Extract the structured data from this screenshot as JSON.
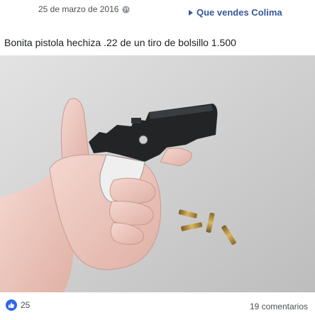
{
  "post": {
    "date": "25 de marzo de 2016",
    "privacy_icon": "globe-icon",
    "group_name": "Que vendes Colima",
    "message": "Bonita pistola hechiza .22 de un tiro de bolsillo 1.500",
    "photo_icon": "derringer-pistol-photo"
  },
  "reactions": {
    "like_icon": "thumbs-up-icon",
    "like_count": "25",
    "comments_label": "19 comentarios"
  },
  "colors": {
    "link": "#365899",
    "like_blue": "#2e67e3",
    "meta_text": "#4b4f56"
  }
}
